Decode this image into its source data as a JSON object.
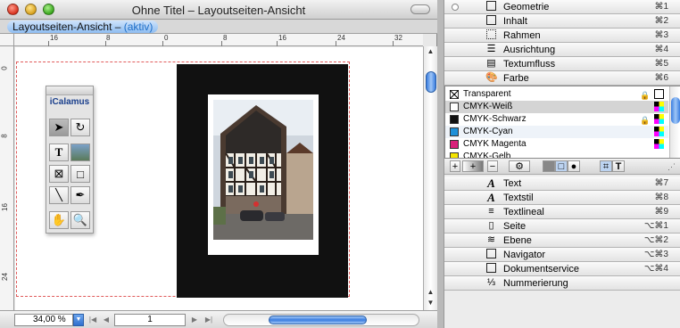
{
  "window": {
    "title": "Ohne Titel – Layoutseiten-Ansicht",
    "view_tab": "Layoutseiten-Ansicht – ",
    "view_tab_active": "(aktiv)"
  },
  "rulers": {
    "horizontal": [
      "16",
      "8",
      "0",
      "8",
      "16",
      "24",
      "32"
    ],
    "vertical": [
      "0",
      "8",
      "16",
      "24"
    ]
  },
  "tool_palette": {
    "brand": "iCalamus",
    "tools": [
      "arrow-tool",
      "rotate-tool",
      "text-tool",
      "image-tool",
      "frame-tool",
      "rect-tool",
      "line-tool",
      "pen-tool",
      "hand-tool",
      "zoom-tool"
    ]
  },
  "statusbar": {
    "zoom": "34,00 %",
    "page": "1"
  },
  "palette": {
    "top_rows": [
      {
        "label": "Geometrie",
        "shortcut": "⌘1",
        "icon": "geometry-icon"
      },
      {
        "label": "Inhalt",
        "shortcut": "⌘2",
        "icon": "content-icon"
      },
      {
        "label": "Rahmen",
        "shortcut": "⌘3",
        "icon": "frame-icon"
      },
      {
        "label": "Ausrichtung",
        "shortcut": "⌘4",
        "icon": "align-icon"
      },
      {
        "label": "Textumfluss",
        "shortcut": "⌘5",
        "icon": "textwrap-icon"
      },
      {
        "label": "Farbe",
        "shortcut": "⌘6",
        "icon": "palette-icon"
      }
    ],
    "colors": [
      {
        "name": "Transparent",
        "swatch": "transparent",
        "locked": true
      },
      {
        "name": "CMYK-Weiß",
        "swatch": "#ffffff",
        "locked": false
      },
      {
        "name": "CMYK-Schwarz",
        "swatch": "#111111",
        "locked": true
      },
      {
        "name": "CMYK-Cyan",
        "swatch": "#1e90d8",
        "locked": false
      },
      {
        "name": "CMYK Magenta",
        "swatch": "#d8207a",
        "locked": false
      },
      {
        "name": "CMYK-Gelb",
        "swatch": "#f4e400",
        "locked": false
      }
    ],
    "bottom_rows": [
      {
        "label": "Text",
        "shortcut": "⌘7",
        "icon": "text-icon"
      },
      {
        "label": "Textstil",
        "shortcut": "⌘8",
        "icon": "textstyle-icon"
      },
      {
        "label": "Textlineal",
        "shortcut": "⌘9",
        "icon": "textruler-icon"
      },
      {
        "label": "Seite",
        "shortcut": "⌥⌘1",
        "icon": "page-icon"
      },
      {
        "label": "Ebene",
        "shortcut": "⌥⌘2",
        "icon": "layer-icon"
      },
      {
        "label": "Navigator",
        "shortcut": "⌥⌘3",
        "icon": "navigator-icon"
      },
      {
        "label": "Dokumentservice",
        "shortcut": "⌥⌘4",
        "icon": "docservice-icon"
      },
      {
        "label": "Nummerierung",
        "shortcut": "",
        "icon": "numbering-icon"
      }
    ]
  },
  "colors": {
    "accent": "#3a7de0",
    "page_black": "#111111",
    "guide": "#e05a5a"
  }
}
